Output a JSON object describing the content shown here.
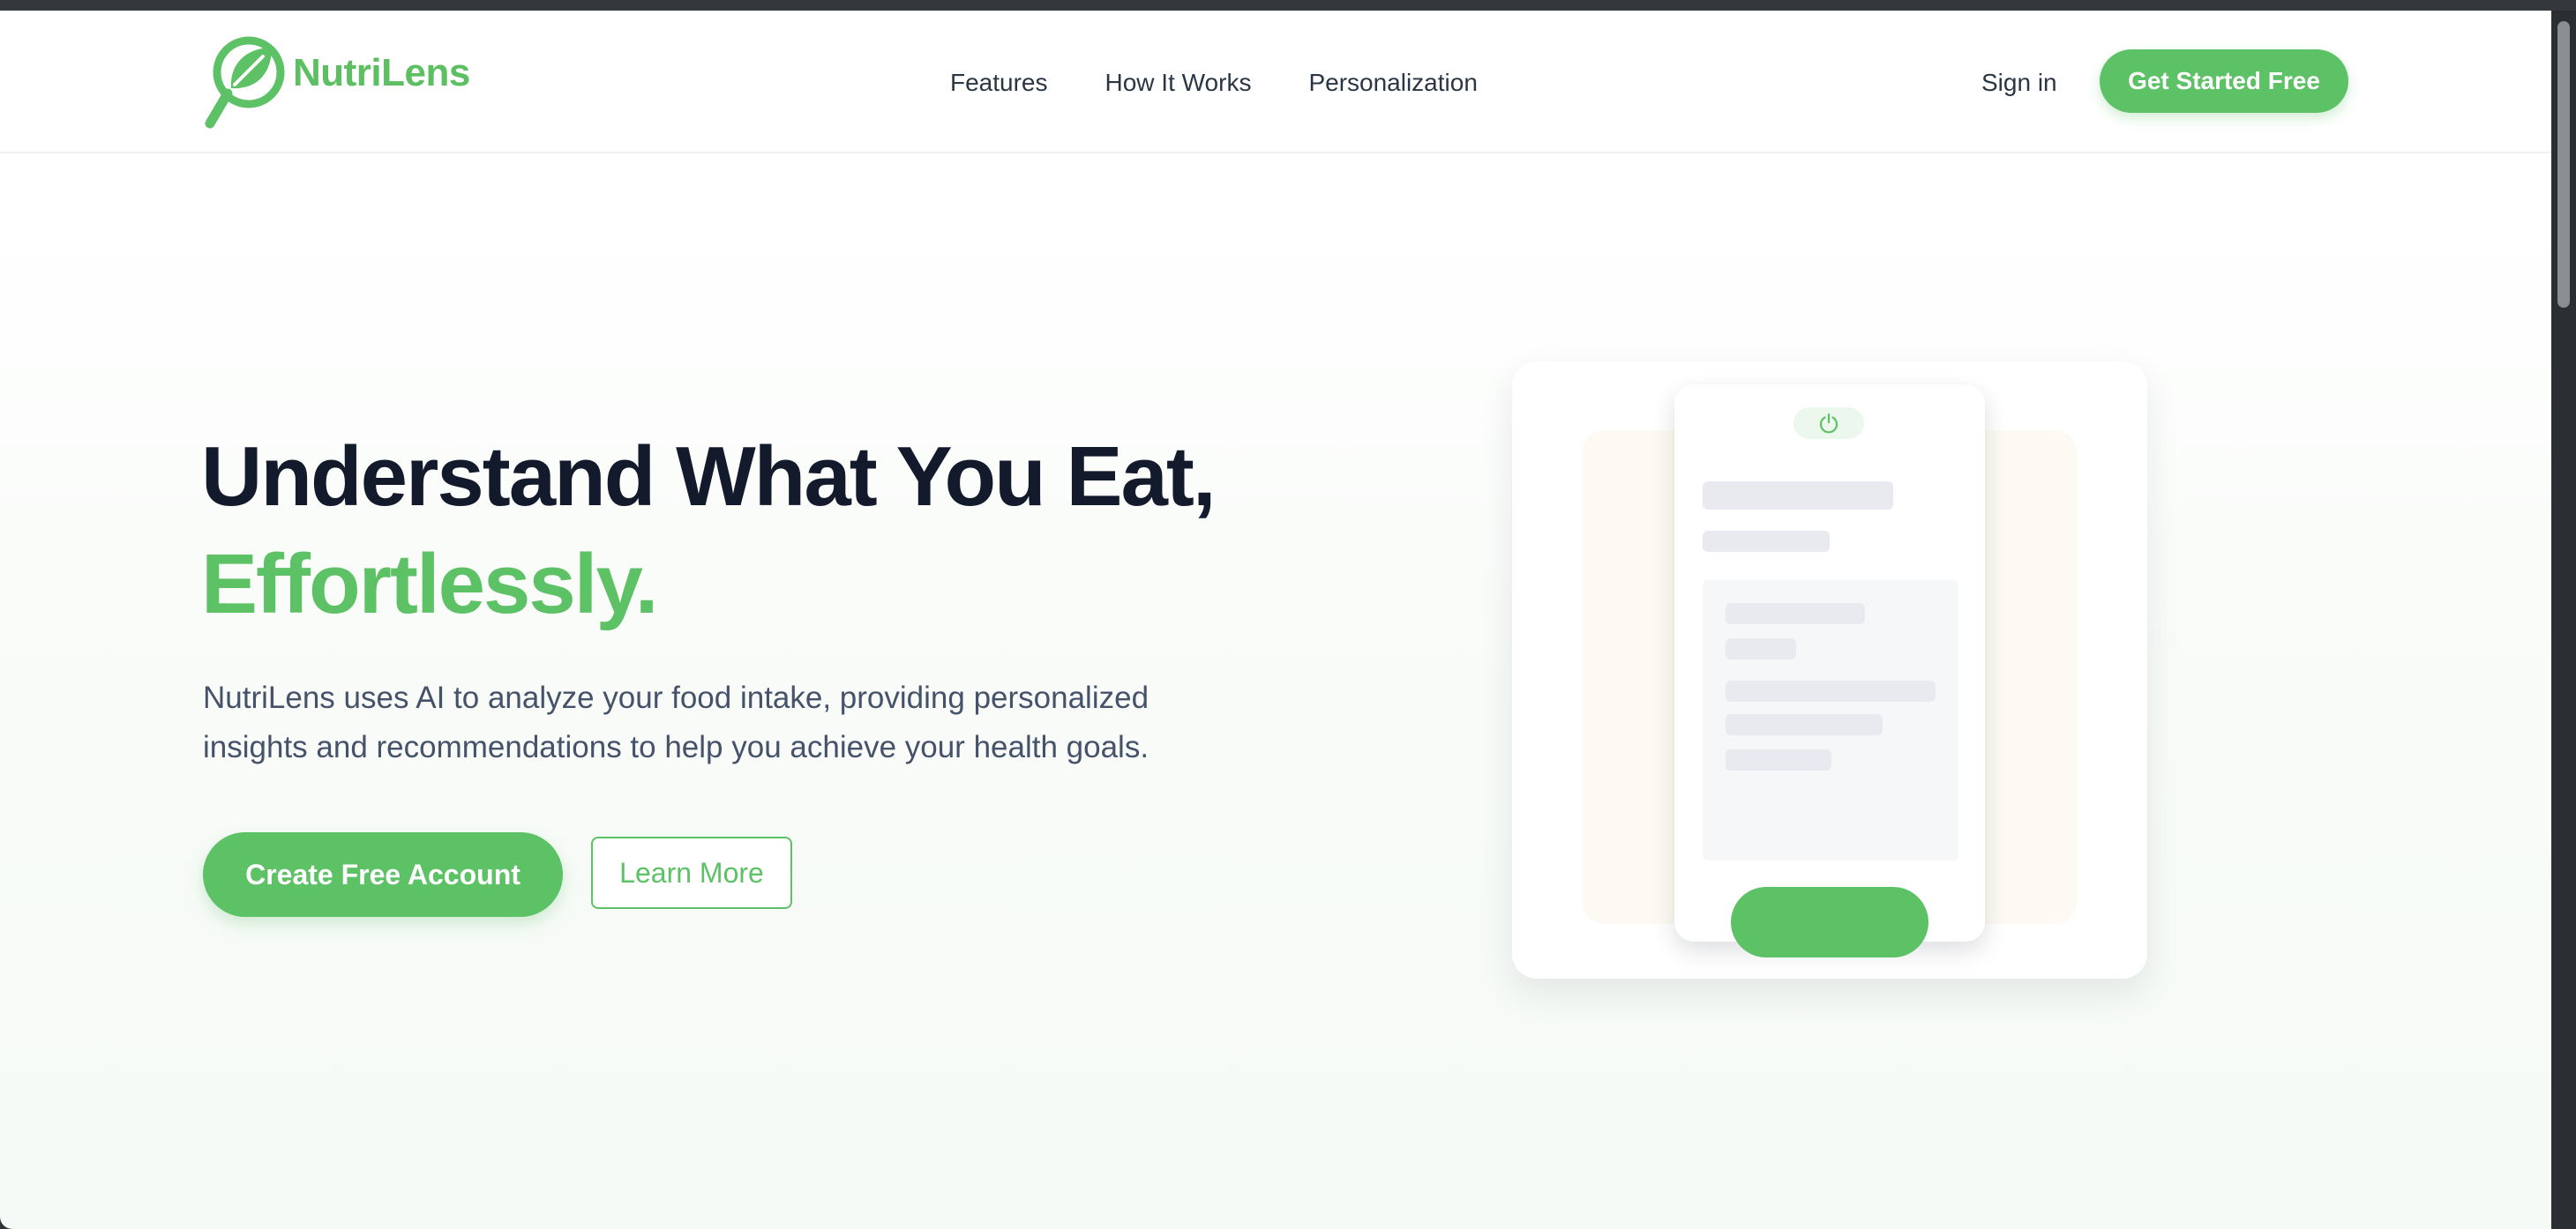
{
  "brand": {
    "name": "NutriLens",
    "accent_color": "#5dc165",
    "logo_icon": "leaf-magnifier-icon"
  },
  "header": {
    "nav": [
      "Features",
      "How It Works",
      "Personalization"
    ],
    "sign_in": "Sign in",
    "cta": "Get Started Free"
  },
  "hero": {
    "title_line1": "Understand What You Eat,",
    "title_line2": "Effortlessly.",
    "subtitle_line1": "NutriLens uses AI to analyze your food intake, providing personalized",
    "subtitle_line2": "insights and recommendations to help you achieve your health goals.",
    "primary_button": "Create Free Account",
    "secondary_button": "Learn More"
  },
  "illustration": {
    "phone_icon": "power-icon"
  }
}
